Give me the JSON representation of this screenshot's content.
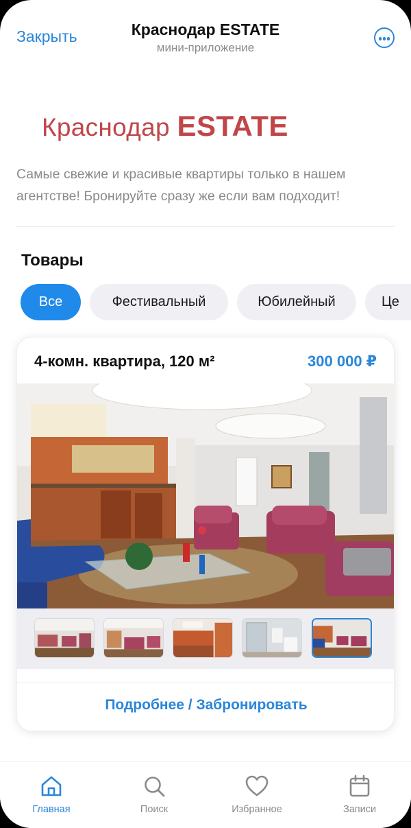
{
  "header": {
    "close_label": "Закрыть",
    "title": "Краснодар ESTATE",
    "subtitle": "мини-приложение",
    "more_icon": "ellipsis-circle-icon"
  },
  "brand": {
    "city": "Краснодар",
    "name": "ESTATE",
    "color": "#c0464a"
  },
  "description": "Самые свежие и красивые квартиры только в нашем агентстве! Бронируйте сразу же если вам подходит!",
  "products": {
    "title": "Товары",
    "filters": [
      {
        "label": "Все",
        "active": true
      },
      {
        "label": "Фестивальный",
        "active": false
      },
      {
        "label": "Юбилейный",
        "active": false
      },
      {
        "label": "Це",
        "active": false
      }
    ]
  },
  "listing": {
    "title": "4-комн. квартира, 120 м²",
    "price": "300 000 ₽",
    "selected_thumbnail": 5,
    "thumbnail_count": 5,
    "action_label": "Подробнее / Забронировать"
  },
  "tabbar": {
    "items": [
      {
        "label": "Главная",
        "icon": "home-icon",
        "active": true
      },
      {
        "label": "Поиск",
        "icon": "search-icon",
        "active": false
      },
      {
        "label": "Избранное",
        "icon": "heart-icon",
        "active": false
      },
      {
        "label": "Записи",
        "icon": "calendar-icon",
        "active": false
      }
    ]
  },
  "colors": {
    "accent": "#2a86d8",
    "chip_active": "#1f8ae9",
    "chip_inactive": "#f0f0f4",
    "muted_text": "#8a8a8e"
  }
}
